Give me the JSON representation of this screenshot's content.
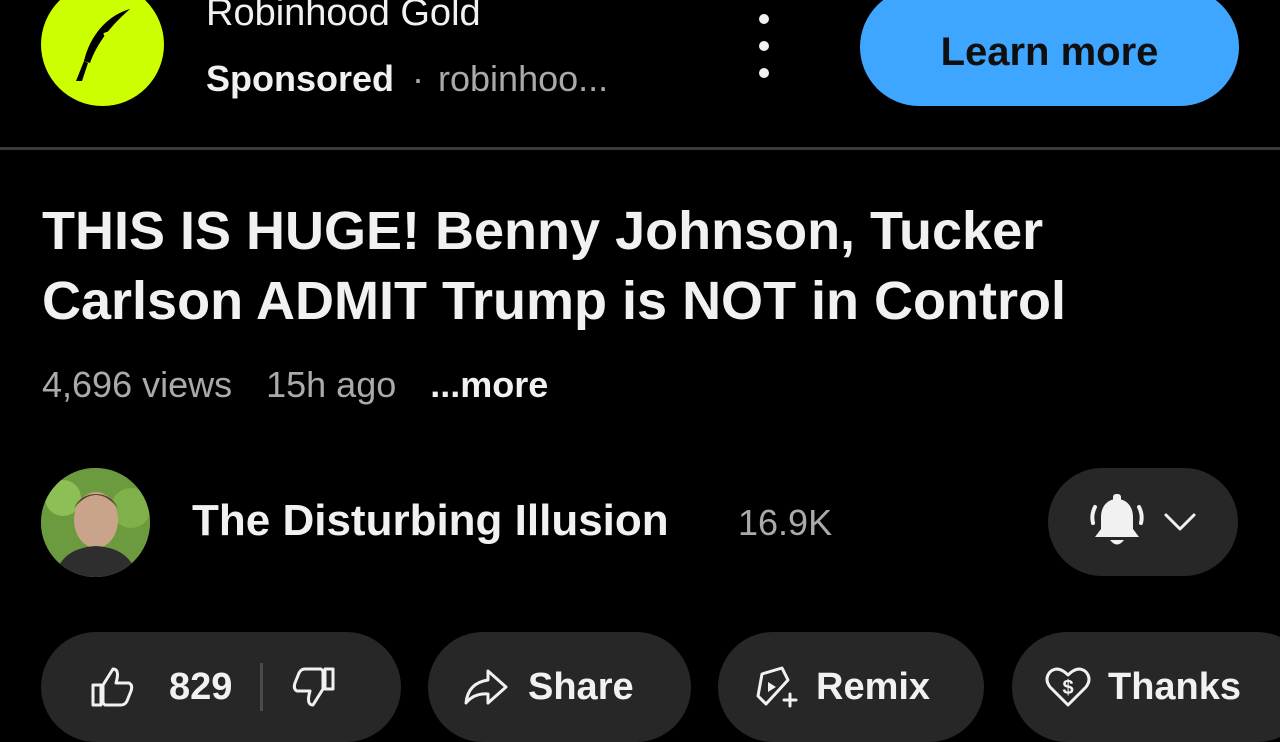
{
  "ad": {
    "title": "Robinhood Gold",
    "sponsored": "Sponsored",
    "separator": "·",
    "domain": "robinhoo...",
    "cta": "Learn more",
    "logo_color": "#ccff00",
    "cta_color": "#3ea6ff",
    "icons": {
      "logo": "robinhood-feather-icon",
      "menu": "more-vert-icon"
    }
  },
  "video": {
    "title": "THIS IS HUGE! Benny Johnson, Tucker Carlson ADMIT Trump is NOT in Control",
    "views": "4,696 views",
    "time_ago": "15h ago",
    "more": "...more"
  },
  "channel": {
    "name": "The Disturbing Illusion",
    "subscribers": "16.9K",
    "icons": {
      "bell": "bell-icon",
      "chevron": "chevron-down-icon"
    }
  },
  "actions": {
    "like_count": "829",
    "share": "Share",
    "remix": "Remix",
    "thanks": "Thanks",
    "icons": {
      "like": "thumbs-up-icon",
      "dislike": "thumbs-down-icon",
      "share": "share-arrow-icon",
      "remix": "remix-icon",
      "thanks": "heart-dollar-icon"
    }
  }
}
